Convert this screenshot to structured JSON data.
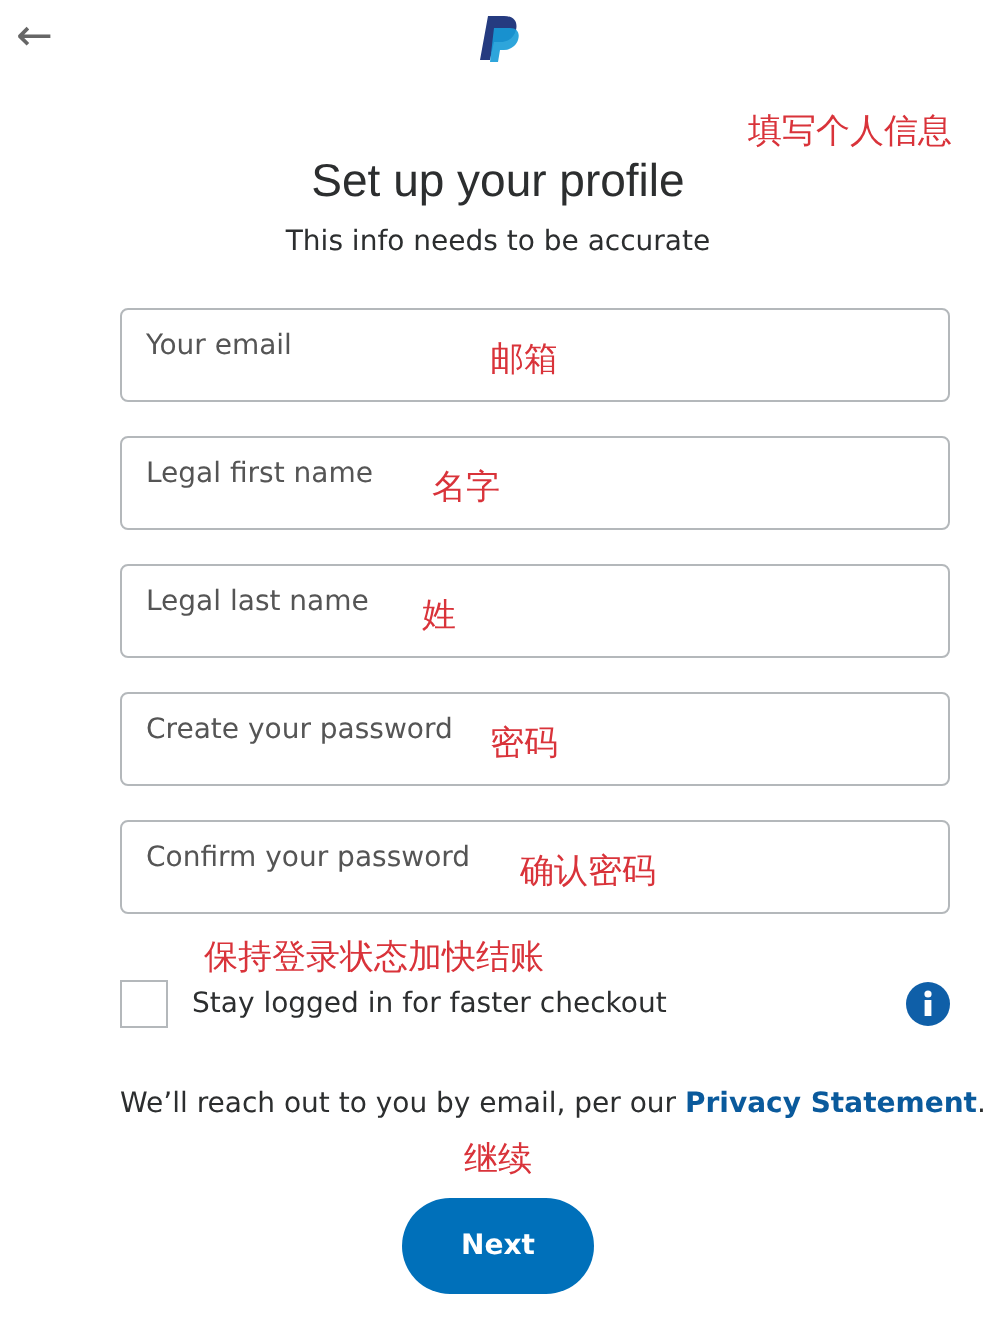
{
  "header": {
    "back": "←"
  },
  "title": "Set up your profile",
  "title_note": "填写个人信息",
  "subtitle": "This info needs to be accurate",
  "fields": [
    {
      "placeholder": "Your email",
      "note": "邮箱"
    },
    {
      "placeholder": "Legal first name",
      "note": "名字"
    },
    {
      "placeholder": "Legal last name",
      "note": "姓"
    },
    {
      "placeholder": "Create your password",
      "note": "密码"
    },
    {
      "placeholder": "Confirm your password",
      "note": "确认密码"
    }
  ],
  "stay_logged_in": {
    "note": "保持登录状态加快结账",
    "label": "Stay logged in for faster checkout",
    "checked": false
  },
  "notice": {
    "text": "We’ll reach out to you by email, per our ",
    "link": "Privacy Statement",
    "end": "."
  },
  "next": {
    "note": "继续",
    "label": "Next"
  }
}
